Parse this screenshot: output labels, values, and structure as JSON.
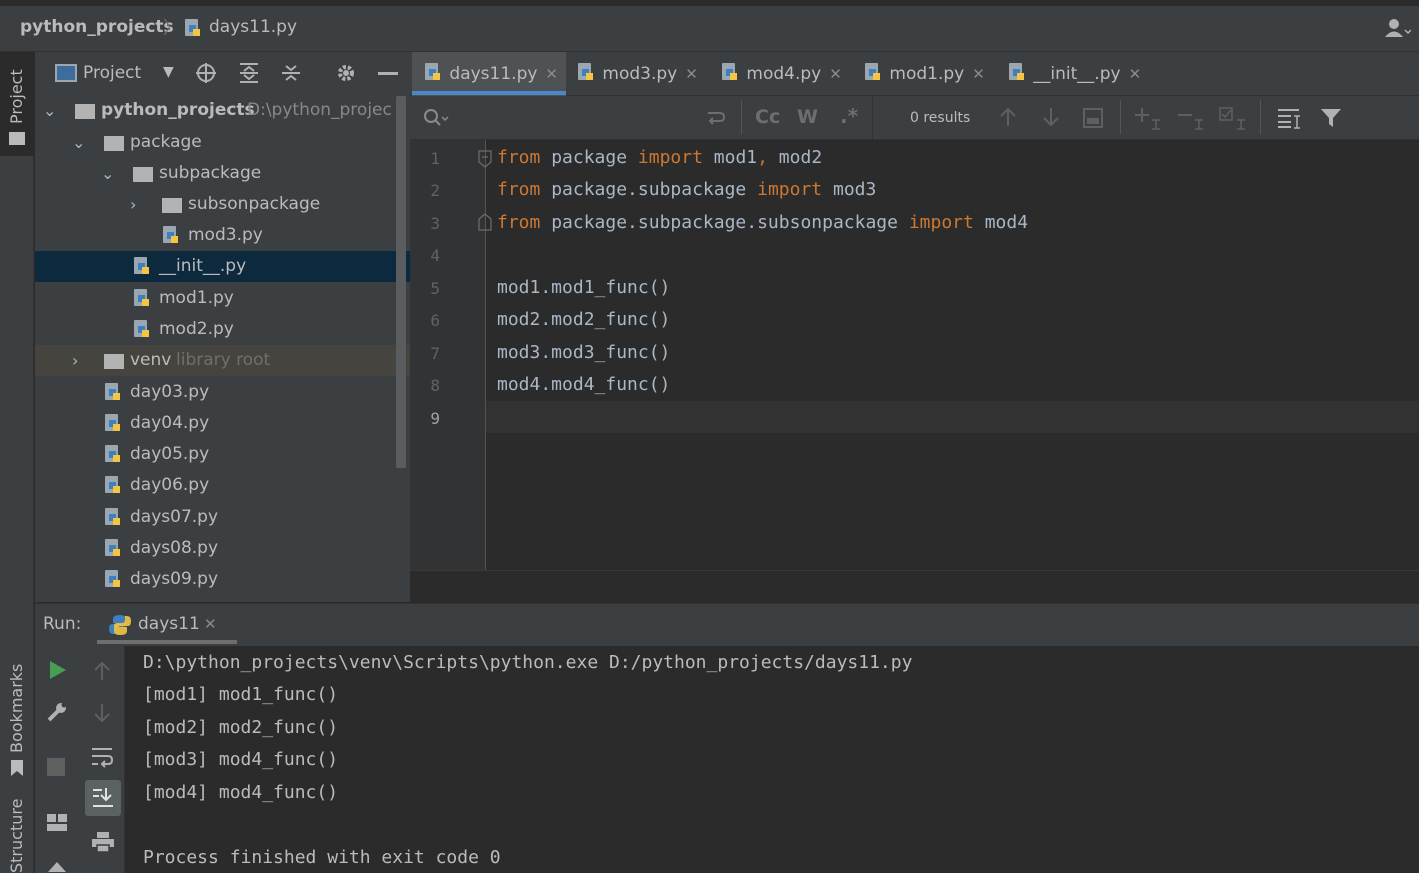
{
  "navbar": {
    "project": "python_projects",
    "file": "days11.py"
  },
  "stripe": {
    "project": "Project",
    "bookmarks": "Bookmarks",
    "structure": "Structure"
  },
  "project_panel": {
    "title": "Project",
    "tree": [
      {
        "label": "python_projects",
        "suffix": "D:\\python_projec",
        "type": "folder",
        "expanded": true
      },
      {
        "label": "package",
        "type": "folder",
        "expanded": true
      },
      {
        "label": "subpackage",
        "type": "folder",
        "expanded": true
      },
      {
        "label": "subsonpackage",
        "type": "folder",
        "expanded": false
      },
      {
        "label": "mod3.py",
        "type": "py"
      },
      {
        "label": "__init__.py",
        "type": "py",
        "selected": true
      },
      {
        "label": "mod1.py",
        "type": "py"
      },
      {
        "label": "mod2.py",
        "type": "py"
      },
      {
        "label": "venv",
        "suffix": "library root",
        "type": "folder",
        "expanded": false
      },
      {
        "label": "day03.py",
        "type": "py"
      },
      {
        "label": "day04.py",
        "type": "py"
      },
      {
        "label": "day05.py",
        "type": "py"
      },
      {
        "label": "day06.py",
        "type": "py"
      },
      {
        "label": "days07.py",
        "type": "py"
      },
      {
        "label": "days08.py",
        "type": "py"
      },
      {
        "label": "days09.py",
        "type": "py"
      }
    ]
  },
  "tabs": [
    {
      "label": "days11.py",
      "active": true
    },
    {
      "label": "mod3.py"
    },
    {
      "label": "mod4.py"
    },
    {
      "label": "mod1.py"
    },
    {
      "label": "__init__.py"
    }
  ],
  "findbar": {
    "results": "0 results",
    "case_label": "Cc",
    "word_label": "W",
    "regex_label": ".*"
  },
  "editor": {
    "line_numbers": [
      "1",
      "2",
      "3",
      "4",
      "5",
      "6",
      "7",
      "8",
      "9"
    ],
    "lines": [
      {
        "kw1": "from",
        "t1": " package ",
        "kw2": "import",
        "t2": " mod1",
        "p": ",",
        "t3": " mod2"
      },
      {
        "kw1": "from",
        "t1": " package.subpackage ",
        "kw2": "import",
        "t2": " mod3"
      },
      {
        "kw1": "from",
        "t1": " package.subpackage.subsonpackage ",
        "kw2": "import",
        "t2": " mod4"
      },
      {
        "text": ""
      },
      {
        "text": "mod1.mod1_func()"
      },
      {
        "text": "mod2.mod2_func()"
      },
      {
        "text": "mod3.mod3_func()"
      },
      {
        "text": "mod4.mod4_func()"
      },
      {
        "text": ""
      }
    ]
  },
  "run": {
    "label": "Run:",
    "tab": "days11",
    "console": [
      "D:\\python_projects\\venv\\Scripts\\python.exe D:/python_projects/days11.py",
      "[mod1] mod1_func()",
      "[mod2] mod2_func()",
      "[mod3] mod4_func()",
      "[mod4] mod4_func()",
      "",
      "Process finished with exit code 0"
    ]
  },
  "colors": {
    "keyword": "#cc7832",
    "accent": "#4a88c7",
    "selection": "#0d293e",
    "run_green": "#499c54"
  }
}
